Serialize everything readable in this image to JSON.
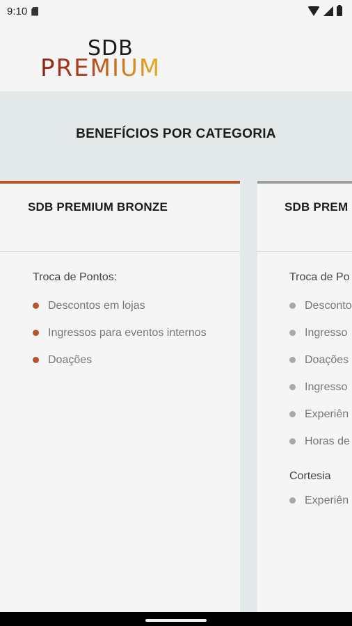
{
  "status_bar": {
    "time": "9:10"
  },
  "header": {
    "logo_top": "SDB",
    "logo_bottom": "PREMIUM"
  },
  "banner": {
    "title": "BENEFÍCIOS POR CATEGORIA"
  },
  "cards": [
    {
      "title": "SDB PREMIUM BRONZE",
      "accent_color": "#b4542a",
      "sections": [
        {
          "title": "Troca de Pontos:",
          "items": [
            "Descontos em lojas",
            "Ingressos para eventos internos",
            "Doações"
          ]
        }
      ]
    },
    {
      "title": "SDB PREM",
      "accent_color": "#9e9e9e",
      "sections": [
        {
          "title": "Troca de Po",
          "items": [
            "Desconto",
            "Ingresso",
            "Doações",
            "Ingresso",
            "Experiên",
            "Horas de"
          ]
        },
        {
          "title": "Cortesia",
          "items": [
            "Experiên PREMIUN"
          ]
        }
      ]
    }
  ]
}
